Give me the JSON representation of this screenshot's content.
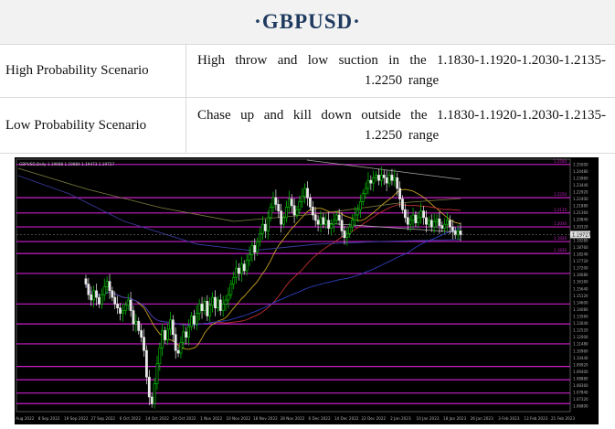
{
  "title": "·GBPUSD·",
  "scenarios": [
    {
      "label": "High Probability Scenario",
      "text": "High throw and low suction in the 1.1830-1.1920-1.2030-1.2135-1.2250 range"
    },
    {
      "label": "Low Probability Scenario",
      "text": "Chase up and kill down outside the 1.1830-1.1920-1.2030-1.2135-1.2250 range"
    }
  ],
  "chart_data": {
    "type": "candlestick",
    "symbol_label": "GBPUSD,Daily  1.19688 1.19884 1.19473 1.19727",
    "x_dates": [
      "30 Aug 2022",
      "8 Sep 2022",
      "19 Sep 2022",
      "27 Sep 2022",
      "6 Oct 2022",
      "14 Oct 2022",
      "24 Oct 2022",
      "1 Nov 2022",
      "10 Nov 2022",
      "18 Nov 2022",
      "28 Nov 2022",
      "6 Dec 2022",
      "14 Dec 2022",
      "22 Dec 2022",
      "2 Jan 2023",
      "10 Jan 2023",
      "18 Jan 2023",
      "26 Jan 2023",
      "3 Feb 2023",
      "13 Feb 2023",
      "21 Feb 2023"
    ],
    "price_labels": [
      "1.25000",
      "1.24480",
      "1.23960",
      "1.23440",
      "1.22920",
      "1.22400",
      "1.21880",
      "1.21360",
      "1.20840",
      "1.20320",
      "1.19800",
      "1.19280",
      "1.18760",
      "1.18240",
      "1.17720",
      "1.17200",
      "1.16680",
      "1.16160",
      "1.15640",
      "1.15120",
      "1.14600",
      "1.14080",
      "1.13560",
      "1.13040",
      "1.12520",
      "1.12000",
      "1.11480",
      "1.10960",
      "1.10440",
      "1.09920",
      "1.09400",
      "1.08880",
      "1.08360",
      "1.07840",
      "1.07320",
      "1.06800"
    ],
    "current_price": "1.19727",
    "levels": [
      {
        "price": 1.25,
        "label": "1.2500"
      },
      {
        "price": 1.225,
        "label": "1.2250"
      },
      {
        "price": 1.2135,
        "label": "1.2135"
      },
      {
        "price": 1.203,
        "label": "1.2030"
      },
      {
        "price": 1.192,
        "label": "1.1920"
      },
      {
        "price": 1.183,
        "label": "1.1830"
      },
      {
        "price": 1.168,
        "label": ""
      },
      {
        "price": 1.145,
        "label": ""
      },
      {
        "price": 1.13,
        "label": ""
      },
      {
        "price": 1.115,
        "label": ""
      },
      {
        "price": 1.098,
        "label": ""
      },
      {
        "price": 1.088,
        "label": ""
      },
      {
        "price": 1.078,
        "label": ""
      },
      {
        "price": 1.07,
        "label": ""
      }
    ],
    "closes": [
      1.16,
      1.152,
      1.148,
      1.155,
      1.15,
      1.145,
      1.152,
      1.158,
      1.162,
      1.155,
      1.15,
      1.145,
      1.142,
      1.138,
      1.14,
      1.144,
      1.148,
      1.14,
      1.13,
      1.132,
      1.125,
      1.12,
      1.11,
      1.09,
      1.075,
      1.07,
      1.085,
      1.1,
      1.112,
      1.125,
      1.118,
      1.126,
      1.133,
      1.122,
      1.11,
      1.108,
      1.116,
      1.124,
      1.12,
      1.128,
      1.136,
      1.13,
      1.138,
      1.145,
      1.14,
      1.147,
      1.136,
      1.144,
      1.15,
      1.142,
      1.148,
      1.14,
      1.145,
      1.148,
      1.152,
      1.16,
      1.165,
      1.172,
      1.168,
      1.175,
      1.17,
      1.178,
      1.182,
      1.189,
      1.184,
      1.192,
      1.198,
      1.205,
      1.2,
      1.21,
      1.218,
      1.225,
      1.22,
      1.215,
      1.205,
      1.21,
      1.218,
      1.224,
      1.219,
      1.212,
      1.216,
      1.222,
      1.226,
      1.232,
      1.225,
      1.218,
      1.212,
      1.208,
      1.205,
      1.21,
      1.205,
      1.208,
      1.202,
      1.205,
      1.208,
      1.212,
      1.208,
      1.2,
      1.195,
      1.198,
      1.203,
      1.208,
      1.212,
      1.216,
      1.222,
      1.228,
      1.232,
      1.238,
      1.236,
      1.24,
      1.242,
      1.238,
      1.242,
      1.24,
      1.236,
      1.242,
      1.238,
      1.24,
      1.232,
      1.224,
      1.216,
      1.21,
      1.205,
      1.208,
      1.212,
      1.206,
      1.21,
      1.215,
      1.21,
      1.205,
      1.208,
      1.203,
      1.207,
      1.209,
      1.204,
      1.202,
      1.205,
      1.208,
      1.203,
      1.2,
      1.197,
      1.2,
      1.197
    ]
  }
}
